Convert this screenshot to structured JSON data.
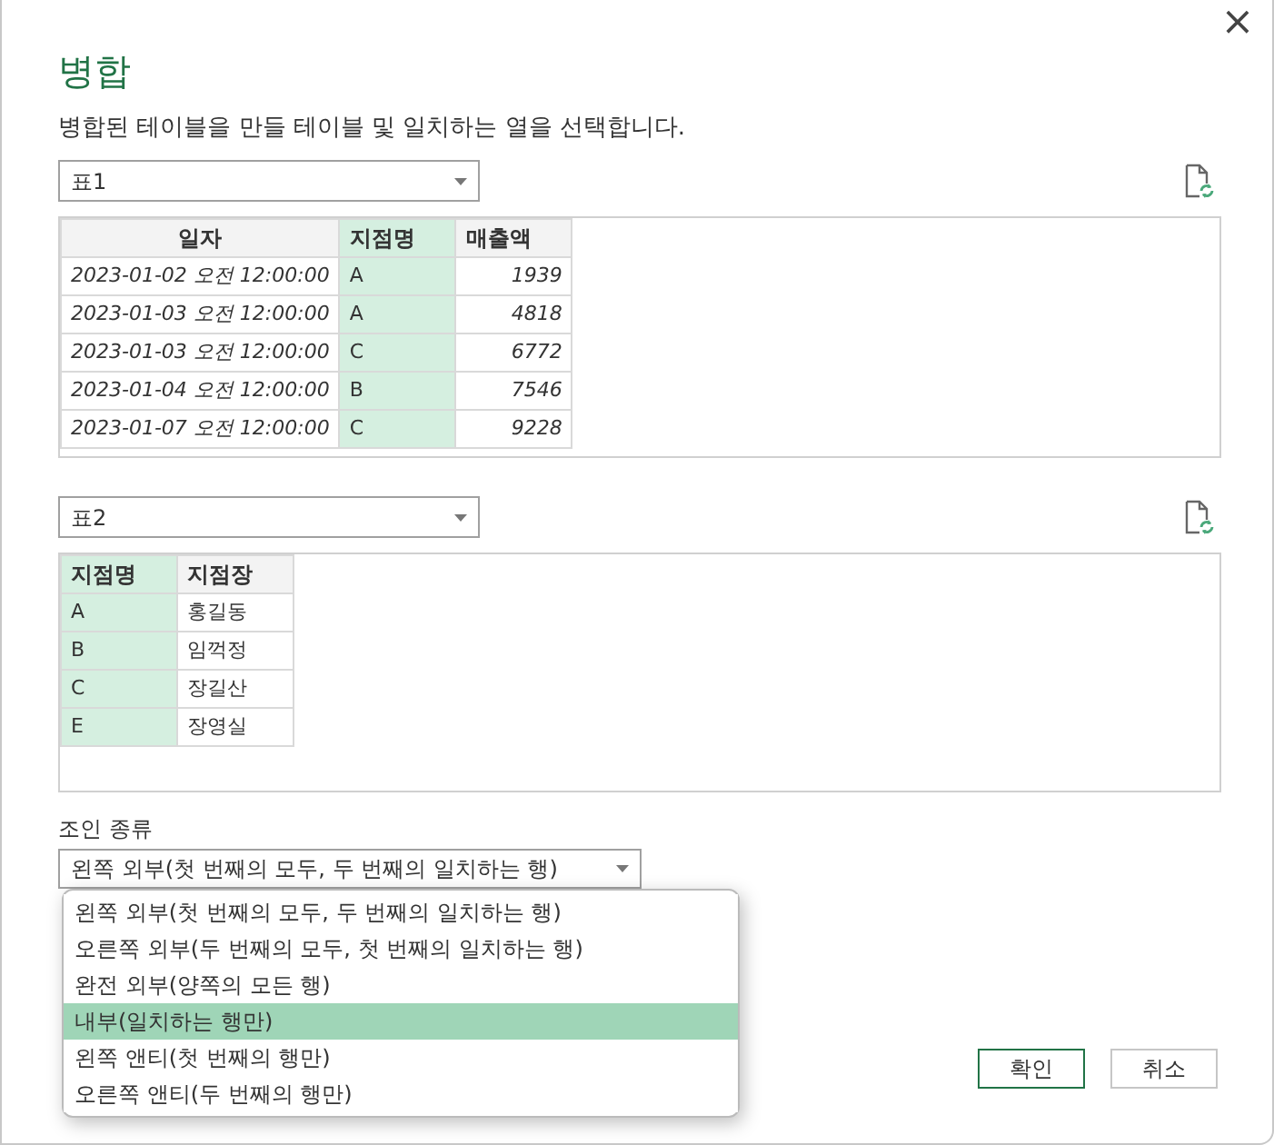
{
  "dialog": {
    "title": "병합",
    "description": "병합된 테이블을 만들 테이블 및 일치하는 열을 선택합니다.",
    "close": "×"
  },
  "tables": [
    {
      "source": "표1",
      "columns": [
        {
          "label": "일자",
          "selected": false
        },
        {
          "label": "지점명",
          "selected": true
        },
        {
          "label": "매출액",
          "selected": false
        }
      ],
      "rows": [
        [
          "2023-01-02 오전 12:00:00",
          "A",
          "1939"
        ],
        [
          "2023-01-03 오전 12:00:00",
          "A",
          "4818"
        ],
        [
          "2023-01-03 오전 12:00:00",
          "C",
          "6772"
        ],
        [
          "2023-01-04 오전 12:00:00",
          "B",
          "7546"
        ],
        [
          "2023-01-07 오전 12:00:00",
          "C",
          "9228"
        ]
      ]
    },
    {
      "source": "표2",
      "columns": [
        {
          "label": "지점명",
          "selected": true
        },
        {
          "label": "지점장",
          "selected": false
        }
      ],
      "rows": [
        [
          "A",
          "홍길동"
        ],
        [
          "B",
          "임꺽정"
        ],
        [
          "C",
          "장길산"
        ],
        [
          "E",
          "장영실"
        ]
      ]
    }
  ],
  "join": {
    "label": "조인 종류",
    "value": "왼쪽 외부(첫 번째의 모두, 두 번째의 일치하는 행)",
    "expanded": true,
    "options": [
      {
        "label": "왼쪽 외부(첫 번째의 모두, 두 번째의 일치하는 행)",
        "highlighted": false
      },
      {
        "label": "오른쪽 외부(두 번째의 모두, 첫 번째의 일치하는 행)",
        "highlighted": false
      },
      {
        "label": "완전 외부(양쪽의 모든 행)",
        "highlighted": false
      },
      {
        "label": "내부(일치하는 행만)",
        "highlighted": true
      },
      {
        "label": "왼쪽 앤티(첫 번째의 행만)",
        "highlighted": false
      },
      {
        "label": "오른쪽 앤티(두 번째의 행만)",
        "highlighted": false
      }
    ]
  },
  "buttons": [
    {
      "label": "확인",
      "primary": true
    },
    {
      "label": "취소",
      "primary": false
    }
  ]
}
